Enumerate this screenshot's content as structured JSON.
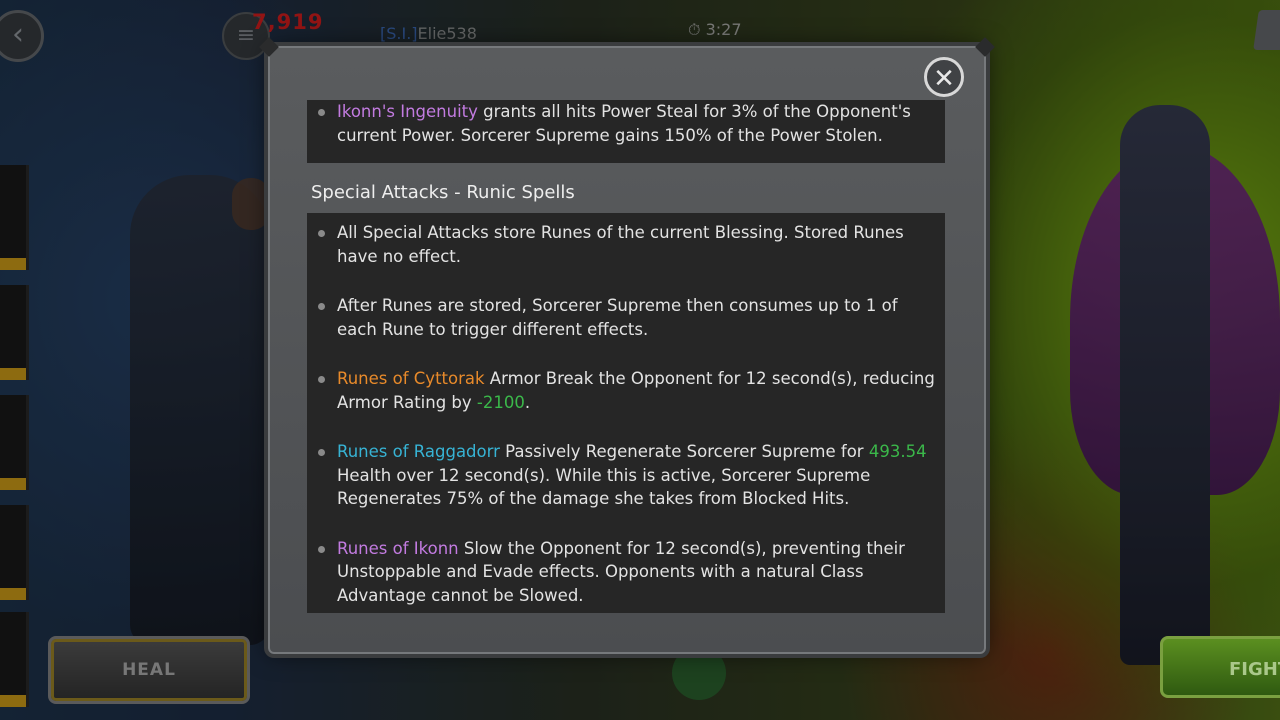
{
  "top_bar": {
    "units": "7,919",
    "player_tag": "[S.I.]",
    "player_name": "Elie538",
    "timer": "3:27"
  },
  "buttons": {
    "heal": "HEAL",
    "fight": "FIGHT"
  },
  "modal": {
    "close_icon": "close-x",
    "top_item": {
      "name": "Ikonn's Ingenuity",
      "text": " grants all hits Power Steal for 3% of the Opponent's current Power. Sorcerer Supreme gains 150% of the Power Stolen."
    },
    "section_title": "Special Attacks - Runic Spells",
    "items": [
      {
        "text": "All Special Attacks store Runes of the current Blessing. Stored Runes have no effect."
      },
      {
        "text": "After Runes are stored, Sorcerer Supreme then consumes up to 1 of each Rune to trigger different effects."
      },
      {
        "name": "Runes of Cyttorak",
        "text1": " Armor Break the Opponent for 12 second(s), reducing Armor Rating by ",
        "value": "-2100",
        "text2": "."
      },
      {
        "name": "Runes of Raggadorr",
        "text1": " Passively Regenerate Sorcerer Supreme for ",
        "value": "493.54",
        "text2": " Health over 12 second(s). While this is active, Sorcerer Supreme Regenerates 75% of the damage she takes from Blocked Hits."
      },
      {
        "name": "Runes of Ikonn",
        "text1": " Slow the Opponent for 12 second(s), preventing their Unstoppable and Evade effects. Opponents with a natural Class Advantage cannot be Slowed."
      }
    ]
  }
}
